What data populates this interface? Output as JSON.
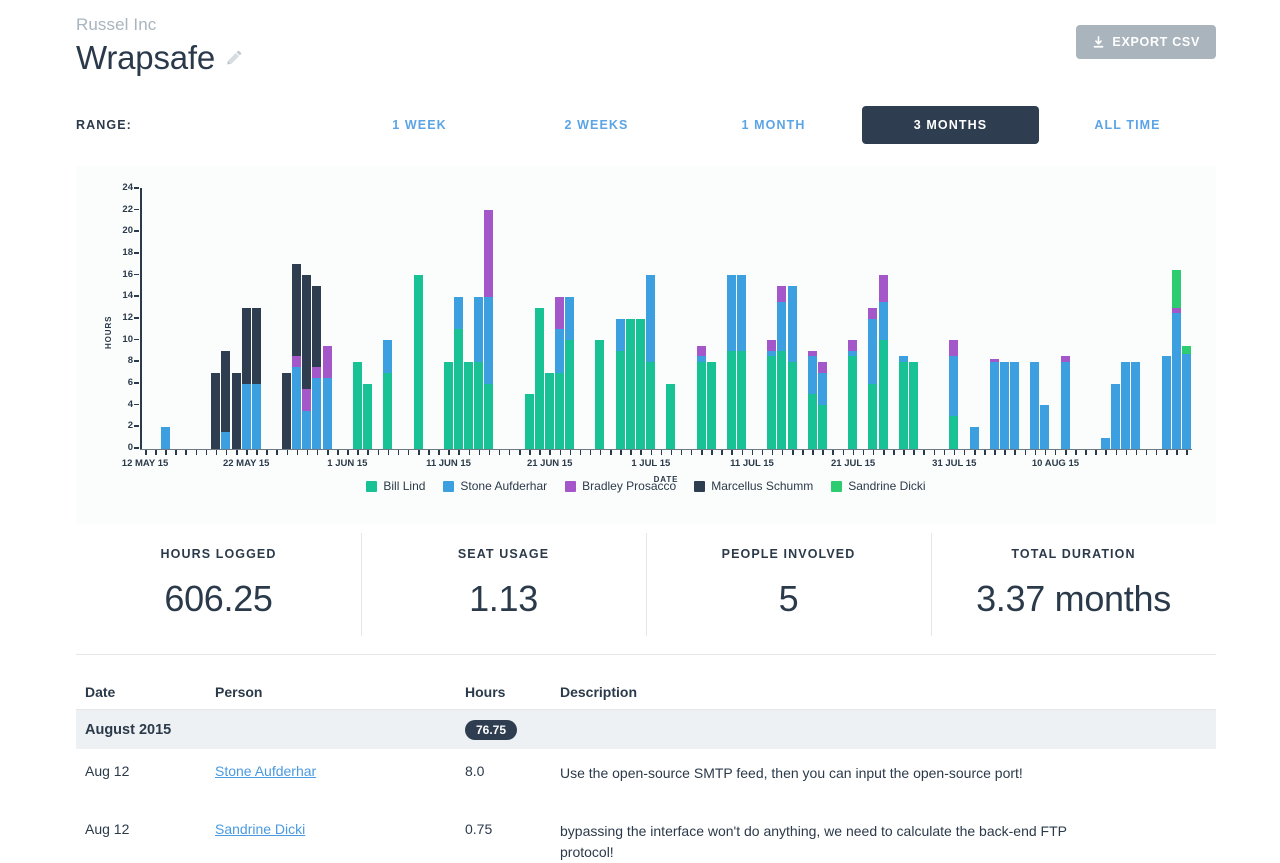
{
  "header": {
    "company": "Russel Inc",
    "project_title": "Wrapsafe",
    "edit_icon": "pencil-icon",
    "export_label": "EXPORT CSV",
    "export_icon": "download-icon"
  },
  "range": {
    "label": "RANGE:",
    "options": [
      {
        "label": "1 WEEK",
        "active": false
      },
      {
        "label": "2 WEEKS",
        "active": false
      },
      {
        "label": "1 MONTH",
        "active": false
      },
      {
        "label": "3 MONTHS",
        "active": true
      },
      {
        "label": "ALL TIME",
        "active": false
      }
    ],
    "active_color": "#2e3e50",
    "link_color": "#5ba4e6"
  },
  "chart_data": {
    "type": "bar",
    "stacked": true,
    "title": "",
    "xlabel": "DATE",
    "ylabel": "HOURS",
    "ylim": [
      0,
      24
    ],
    "yticks": [
      0,
      2,
      4,
      6,
      8,
      10,
      12,
      14,
      16,
      18,
      20,
      22,
      24
    ],
    "grid": false,
    "legend_position": "bottom",
    "series": [
      {
        "name": "Bill Lind",
        "color": "#18c295"
      },
      {
        "name": "Stone Aufderhar",
        "color": "#3b9fe0"
      },
      {
        "name": "Bradley Prosacco",
        "color": "#a457c9"
      },
      {
        "name": "Marcellus Schumm",
        "color": "#2e3e50"
      },
      {
        "name": "Sandrine Dicki",
        "color": "#2ecc71"
      }
    ],
    "x_tick_labels": [
      {
        "label": "12 MAY 15",
        "index": 0
      },
      {
        "label": "22 MAY 15",
        "index": 10
      },
      {
        "label": "1 JUN 15",
        "index": 20
      },
      {
        "label": "11 JUN 15",
        "index": 30
      },
      {
        "label": "21 JUN 15",
        "index": 40
      },
      {
        "label": "1 JUL 15",
        "index": 50
      },
      {
        "label": "11 JUL 15",
        "index": 60
      },
      {
        "label": "21 JUL 15",
        "index": 70
      },
      {
        "label": "31 JUL 15",
        "index": 80
      },
      {
        "label": "10 AUG 15",
        "index": 90
      }
    ],
    "categories": [
      "12 May 15",
      "13 May 15",
      "14 May 15",
      "15 May 15",
      "16 May 15",
      "17 May 15",
      "18 May 15",
      "19 May 15",
      "20 May 15",
      "21 May 15",
      "22 May 15",
      "23 May 15",
      "24 May 15",
      "25 May 15",
      "26 May 15",
      "27 May 15",
      "28 May 15",
      "29 May 15",
      "30 May 15",
      "31 May 15",
      "1 Jun 15",
      "2 Jun 15",
      "3 Jun 15",
      "4 Jun 15",
      "5 Jun 15",
      "6 Jun 15",
      "7 Jun 15",
      "8 Jun 15",
      "9 Jun 15",
      "10 Jun 15",
      "11 Jun 15",
      "12 Jun 15",
      "13 Jun 15",
      "14 Jun 15",
      "15 Jun 15",
      "16 Jun 15",
      "17 Jun 15",
      "18 Jun 15",
      "19 Jun 15",
      "20 Jun 15",
      "21 Jun 15",
      "22 Jun 15",
      "23 Jun 15",
      "24 Jun 15",
      "25 Jun 15",
      "26 Jun 15",
      "27 Jun 15",
      "28 Jun 15",
      "29 Jun 15",
      "30 Jun 15",
      "1 Jul 15",
      "2 Jul 15",
      "3 Jul 15",
      "4 Jul 15",
      "5 Jul 15",
      "6 Jul 15",
      "7 Jul 15",
      "8 Jul 15",
      "9 Jul 15",
      "10 Jul 15",
      "11 Jul 15",
      "12 Jul 15",
      "13 Jul 15",
      "14 Jul 15",
      "15 Jul 15",
      "16 Jul 15",
      "17 Jul 15",
      "18 Jul 15",
      "19 Jul 15",
      "20 Jul 15",
      "21 Jul 15",
      "22 Jul 15",
      "23 Jul 15",
      "24 Jul 15",
      "25 Jul 15",
      "26 Jul 15",
      "27 Jul 15",
      "28 Jul 15",
      "29 Jul 15",
      "30 Jul 15",
      "31 Jul 15",
      "1 Aug 15",
      "2 Aug 15",
      "3 Aug 15",
      "4 Aug 15",
      "5 Aug 15",
      "6 Aug 15",
      "7 Aug 15",
      "8 Aug 15",
      "9 Aug 15",
      "10 Aug 15",
      "11 Aug 15",
      "12 Aug 15"
    ],
    "stacks": [
      [
        0,
        0,
        0,
        0,
        0
      ],
      [
        0,
        0,
        0,
        0,
        0
      ],
      [
        0,
        2,
        0,
        0,
        0
      ],
      [
        0,
        0,
        0,
        0,
        0
      ],
      [
        0,
        0,
        0,
        0,
        0
      ],
      [
        0,
        0,
        0,
        0,
        0
      ],
      [
        0,
        0,
        0,
        0,
        0
      ],
      [
        0,
        0,
        0,
        7,
        0
      ],
      [
        0,
        1.5,
        0,
        7.5,
        0
      ],
      [
        0,
        0,
        0,
        7,
        0
      ],
      [
        0,
        6,
        0,
        7,
        0
      ],
      [
        0,
        6,
        0,
        7,
        0
      ],
      [
        0,
        0,
        0,
        0,
        0
      ],
      [
        0,
        0,
        0,
        0,
        0
      ],
      [
        0,
        0,
        0,
        7,
        0
      ],
      [
        0,
        7.5,
        1,
        8.5,
        0
      ],
      [
        0,
        3.5,
        2,
        10.5,
        0
      ],
      [
        0,
        6.5,
        1,
        7.5,
        0
      ],
      [
        0,
        6.5,
        3,
        0,
        0
      ],
      [
        0,
        0,
        0,
        0,
        0
      ],
      [
        0,
        0,
        0,
        0,
        0
      ],
      [
        8,
        0,
        0,
        0,
        0
      ],
      [
        6,
        0,
        0,
        0,
        0
      ],
      [
        0,
        0,
        0,
        0,
        0
      ],
      [
        7,
        3,
        0,
        0,
        0
      ],
      [
        0,
        0,
        0,
        0,
        0
      ],
      [
        0,
        0,
        0,
        0,
        0
      ],
      [
        16,
        0,
        0,
        0,
        0
      ],
      [
        0,
        0,
        0,
        0,
        0
      ],
      [
        0,
        0,
        0,
        0,
        0
      ],
      [
        8,
        0,
        0,
        0,
        0
      ],
      [
        11,
        3,
        0,
        0,
        0
      ],
      [
        8,
        0,
        0,
        0,
        0
      ],
      [
        8,
        6,
        0,
        0,
        0
      ],
      [
        6,
        8,
        8,
        0,
        0
      ],
      [
        0,
        0,
        0,
        0,
        0
      ],
      [
        0,
        0,
        0,
        0,
        0
      ],
      [
        0,
        0,
        0,
        0,
        0
      ],
      [
        5,
        0,
        0,
        0,
        0
      ],
      [
        13,
        0,
        0,
        0,
        0
      ],
      [
        7,
        0,
        0,
        0,
        0
      ],
      [
        7,
        4,
        3,
        0,
        0
      ],
      [
        10,
        4,
        0,
        0,
        0
      ],
      [
        0,
        0,
        0,
        0,
        0
      ],
      [
        0,
        0,
        0,
        0,
        0
      ],
      [
        10,
        0,
        0,
        0,
        0
      ],
      [
        0,
        0,
        0,
        0,
        0
      ],
      [
        9,
        3,
        0,
        0,
        0
      ],
      [
        12,
        0,
        0,
        0,
        0
      ],
      [
        12,
        0,
        0,
        0,
        0
      ],
      [
        8,
        8,
        0,
        0,
        0
      ],
      [
        0,
        0,
        0,
        0,
        0
      ],
      [
        6,
        0,
        0,
        0,
        0
      ],
      [
        0,
        0,
        0,
        0,
        0
      ],
      [
        0,
        0,
        0,
        0,
        0
      ],
      [
        8,
        0.5,
        1,
        0,
        0
      ],
      [
        8,
        0,
        0,
        0,
        0
      ],
      [
        0,
        0,
        0,
        0,
        0
      ],
      [
        9,
        7,
        0,
        0,
        0
      ],
      [
        9,
        7,
        0,
        0,
        0
      ],
      [
        0,
        0,
        0,
        0,
        0
      ],
      [
        0,
        0,
        0,
        0,
        0
      ],
      [
        8.5,
        0.5,
        1,
        0,
        0
      ],
      [
        9,
        4.5,
        1.5,
        0,
        0
      ],
      [
        8,
        7,
        0,
        0,
        0
      ],
      [
        0,
        0,
        0,
        0,
        0
      ],
      [
        5,
        3.5,
        0.5,
        0,
        0
      ],
      [
        4,
        3,
        1,
        0,
        0
      ],
      [
        0,
        0,
        0,
        0,
        0
      ],
      [
        0,
        0,
        0,
        0,
        0
      ],
      [
        8.5,
        0.5,
        1,
        0,
        0
      ],
      [
        0,
        0,
        0,
        0,
        0
      ],
      [
        6,
        6,
        1,
        0,
        0
      ],
      [
        10,
        3.5,
        2.5,
        0,
        0
      ],
      [
        0,
        0,
        0,
        0,
        0
      ],
      [
        8,
        0.5,
        0,
        0,
        0
      ],
      [
        8,
        0,
        0,
        0,
        0
      ],
      [
        0,
        0,
        0,
        0,
        0
      ],
      [
        0,
        0,
        0,
        0,
        0
      ],
      [
        0,
        0,
        0,
        0,
        0
      ],
      [
        3,
        5.5,
        1.5,
        0,
        0
      ],
      [
        0,
        0,
        0,
        0,
        0
      ],
      [
        0,
        2,
        0,
        0,
        0
      ],
      [
        0,
        0,
        0,
        0,
        0
      ],
      [
        0,
        8,
        0.25,
        0,
        0
      ],
      [
        0,
        8,
        0,
        0,
        0
      ],
      [
        0,
        8,
        0,
        0,
        0
      ],
      [
        0,
        0,
        0,
        0,
        0
      ],
      [
        0,
        8,
        0,
        0,
        0
      ],
      [
        0,
        4,
        0,
        0,
        0
      ],
      [
        0,
        0,
        0,
        0,
        0
      ],
      [
        0,
        8,
        0.5,
        0,
        0
      ],
      [
        0,
        0,
        0,
        0,
        0
      ],
      [
        0,
        0,
        0,
        0,
        0
      ],
      [
        0,
        0,
        0,
        0,
        0
      ],
      [
        0,
        1,
        0,
        0,
        0
      ],
      [
        0,
        6,
        0,
        0,
        0
      ],
      [
        0,
        8,
        0,
        0,
        0
      ],
      [
        0,
        8,
        0,
        0,
        0
      ],
      [
        0,
        0,
        0,
        0,
        0
      ],
      [
        0,
        0,
        0,
        0,
        0
      ],
      [
        0,
        8.5,
        0,
        0,
        0
      ],
      [
        0,
        12.5,
        0.5,
        0,
        3.5
      ],
      [
        0,
        8.75,
        0,
        0,
        0.75
      ]
    ]
  },
  "stats": [
    {
      "label": "HOURS LOGGED",
      "value": "606.25"
    },
    {
      "label": "SEAT USAGE",
      "value": "1.13"
    },
    {
      "label": "PEOPLE INVOLVED",
      "value": "5"
    },
    {
      "label": "TOTAL DURATION",
      "value": "3.37 months"
    }
  ],
  "table": {
    "columns": {
      "date": "Date",
      "person": "Person",
      "hours": "Hours",
      "description": "Description"
    },
    "group": {
      "title": "August 2015",
      "total_hours": "76.75"
    },
    "rows": [
      {
        "date": "Aug 12",
        "person": "Stone Aufderhar",
        "hours": "8.0",
        "description": "Use the open-source SMTP feed, then you can input the open-source port!"
      },
      {
        "date": "Aug 12",
        "person": "Sandrine Dicki",
        "hours": "0.75",
        "description": "bypassing the interface won't do anything, we need to calculate the back-end FTP protocol!"
      }
    ]
  }
}
